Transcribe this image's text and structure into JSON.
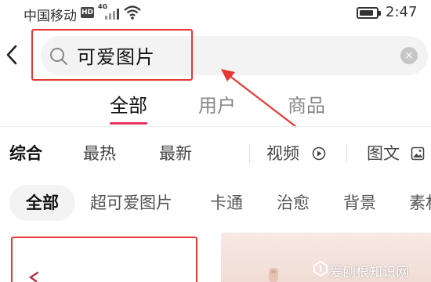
{
  "status_bar": {
    "carrier": "中国移动",
    "hd_badge": "HD",
    "network": "4G",
    "time": "2:47",
    "battery_level": 0.85
  },
  "search": {
    "query": "可爱图片",
    "clear_symbol": "×"
  },
  "tabs": [
    {
      "label": "全部",
      "active": true
    },
    {
      "label": "用户",
      "active": false
    },
    {
      "label": "商品",
      "active": false
    }
  ],
  "sort_options": [
    {
      "label": "综合",
      "active": true
    },
    {
      "label": "最热"
    },
    {
      "label": "最新"
    },
    {
      "label": "视频",
      "icon": "play-circle-icon"
    },
    {
      "label": "图文",
      "icon": "image-icon"
    }
  ],
  "chips": [
    {
      "label": "全部",
      "active": true
    },
    {
      "label": "超可爱图片"
    },
    {
      "label": "卡通"
    },
    {
      "label": "治愈"
    },
    {
      "label": "背景"
    },
    {
      "label": "素材"
    }
  ],
  "watermark": "爱刨根知识网",
  "colors": {
    "accent": "#e8335a",
    "annotation": "#e53935",
    "search_bg": "#f3f3f3"
  }
}
